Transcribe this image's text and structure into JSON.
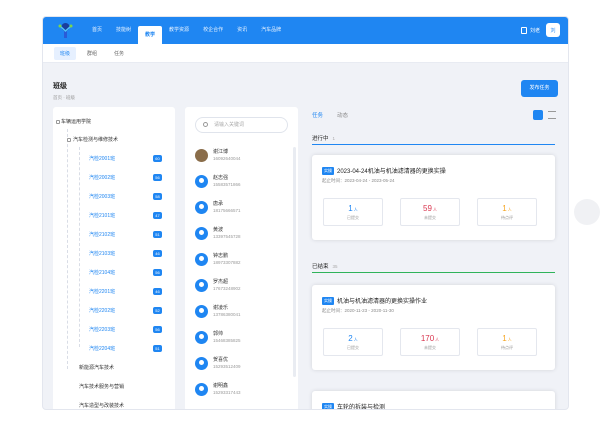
{
  "nav": {
    "items": [
      "首页",
      "技能树",
      "教学",
      "教学资源",
      "校企合作",
      "资讯",
      "汽车品牌"
    ],
    "active_index": 2
  },
  "topright": {
    "user": "刘老",
    "avatar_text": "刘"
  },
  "subnav": {
    "items": [
      "班级",
      "群组",
      "任务"
    ],
    "active_index": 0
  },
  "page": {
    "title": "班级",
    "breadcrumb": "首页 · 班级",
    "publish_button": "发布任务"
  },
  "tree": {
    "root": "车辆运用学院",
    "group": "汽车检测与维修技术",
    "classes": [
      {
        "name": "汽检2001班",
        "count": "60"
      },
      {
        "name": "汽检2002班",
        "count": "56"
      },
      {
        "name": "汽检2003班",
        "count": "58"
      },
      {
        "name": "汽检2101班",
        "count": "47"
      },
      {
        "name": "汽检2102班",
        "count": "51"
      },
      {
        "name": "汽检2103班",
        "count": "46"
      },
      {
        "name": "汽检2104班",
        "count": "56"
      },
      {
        "name": "汽检2201班",
        "count": "46"
      },
      {
        "name": "汽检2202班",
        "count": "52"
      },
      {
        "name": "汽检2203班",
        "count": "56"
      },
      {
        "name": "汽检2204班",
        "count": "51"
      }
    ],
    "others": [
      "新能源汽车技术",
      "汽车技术服务与营销",
      "汽车造型与改装技术"
    ]
  },
  "students": {
    "search_placeholder": "请输入关键词",
    "list": [
      {
        "name": "谢江博",
        "phone": "16092640044"
      },
      {
        "name": "赵志强",
        "phone": "15583571866"
      },
      {
        "name": "唐承",
        "phone": "18175666571"
      },
      {
        "name": "黄波",
        "phone": "13397545728"
      },
      {
        "name": "钟志鹏",
        "phone": "18973307882"
      },
      {
        "name": "罗杰超",
        "phone": "17673248902"
      },
      {
        "name": "谢凌乐",
        "phone": "13786380041"
      },
      {
        "name": "郭帅",
        "phone": "15468385825"
      },
      {
        "name": "贺喜优",
        "phone": "15293512409"
      },
      {
        "name": "谢明鑫",
        "phone": "15293317443"
      }
    ]
  },
  "tasks": {
    "tabs": [
      "任务",
      "动态"
    ],
    "active_tab": 0,
    "sections": [
      {
        "title": "进行中",
        "count": "1",
        "color": "#1f86f2"
      },
      {
        "title": "已结束",
        "count": "35",
        "color": "#2fb35a"
      }
    ],
    "cards": [
      {
        "tag": "实操",
        "title": "2023-04-24机油与机油滤清器的更换实操",
        "date": "起止时间：2023-04-24 - 2023-05-24",
        "stats": [
          {
            "n": "1",
            "unit": "人",
            "label": "已提交",
            "color": "#1f86f2"
          },
          {
            "n": "59",
            "unit": "人",
            "label": "未提交",
            "color": "#d9364f"
          },
          {
            "n": "1",
            "unit": "人",
            "label": "待点评",
            "color": "#f5a623"
          }
        ]
      },
      {
        "tag": "实操",
        "title": "机油与机油滤清器的更换实操作业",
        "date": "起止时间：2020-11-23 - 2020-11-30",
        "stats": [
          {
            "n": "2",
            "unit": "人",
            "label": "已提交",
            "color": "#1f86f2"
          },
          {
            "n": "170",
            "unit": "人",
            "label": "未提交",
            "color": "#d9364f"
          },
          {
            "n": "1",
            "unit": "人",
            "label": "待点评",
            "color": "#f5a623"
          }
        ]
      },
      {
        "tag": "实操",
        "title": "车轮的拆装与检测",
        "date": "起止时间：2020-10-04 - 2020-10-07"
      }
    ]
  }
}
